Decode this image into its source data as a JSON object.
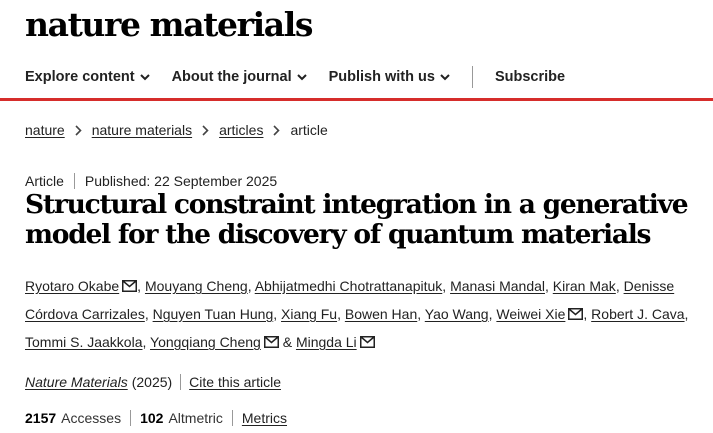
{
  "site": {
    "logo": "nature materials"
  },
  "nav": {
    "items": [
      {
        "label": "Explore content"
      },
      {
        "label": "About the journal"
      },
      {
        "label": "Publish with us"
      }
    ],
    "subscribe": "Subscribe"
  },
  "colors": {
    "accent_bar": "#d62d2b"
  },
  "breadcrumb": [
    "nature",
    "nature materials",
    "articles",
    "article"
  ],
  "article": {
    "type": "Article",
    "published": "Published: 22 September 2025",
    "title": "Structural constraint integration in a generative model for the discovery of quantum materials",
    "authors": [
      {
        "name": "Ryotaro Okabe",
        "email": true
      },
      {
        "name": "Mouyang Cheng",
        "email": false
      },
      {
        "name": "Abhijatmedhi Chotrattanapituk",
        "email": false
      },
      {
        "name": "Manasi Mandal",
        "email": false
      },
      {
        "name": "Kiran Mak",
        "email": false
      },
      {
        "name": "Denisse Córdova Carrizales",
        "email": false
      },
      {
        "name": "Nguyen Tuan Hung",
        "email": false
      },
      {
        "name": "Xiang Fu",
        "email": false
      },
      {
        "name": "Bowen Han",
        "email": false
      },
      {
        "name": "Yao Wang",
        "email": false
      },
      {
        "name": "Weiwei Xie",
        "email": true
      },
      {
        "name": "Robert J. Cava",
        "email": false
      },
      {
        "name": "Tommi S. Jaakkola",
        "email": false
      },
      {
        "name": "Yongqiang Cheng",
        "email": true
      },
      {
        "name": "Mingda Li",
        "email": true
      }
    ],
    "journal": "Nature Materials",
    "year": "(2025)",
    "cite": "Cite this article",
    "accesses_value": "2157",
    "accesses_label": "Accesses",
    "altmetric_value": "102",
    "altmetric_label": "Altmetric",
    "metrics_link": "Metrics"
  }
}
